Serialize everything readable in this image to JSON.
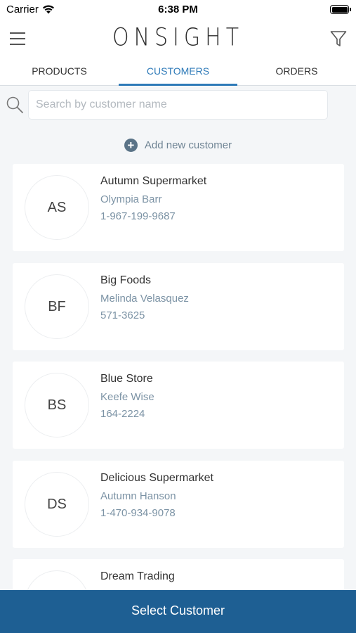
{
  "status_bar": {
    "carrier": "Carrier",
    "time": "6:38 PM"
  },
  "header": {
    "logo": "ONSIGHT",
    "menu_icon": "hamburger-menu-icon",
    "filter_icon": "filter-funnel-icon"
  },
  "tabs": [
    {
      "label": "PRODUCTS",
      "active": false
    },
    {
      "label": "CUSTOMERS",
      "active": true
    },
    {
      "label": "ORDERS",
      "active": false
    }
  ],
  "search": {
    "placeholder": "Search by customer name",
    "value": ""
  },
  "add_customer": {
    "label": "Add new customer",
    "icon": "plus-circle-icon"
  },
  "customers": [
    {
      "initials": "AS",
      "name": "Autumn Supermarket",
      "contact": "Olympia Barr",
      "phone": "1-967-199-9687"
    },
    {
      "initials": "BF",
      "name": "Big Foods",
      "contact": "Melinda Velasquez",
      "phone": "571-3625"
    },
    {
      "initials": "BS",
      "name": "Blue Store",
      "contact": "Keefe Wise",
      "phone": "164-2224"
    },
    {
      "initials": "DS",
      "name": "Delicious Supermarket",
      "contact": "Autumn Hanson",
      "phone": "1-470-934-9078"
    },
    {
      "initials": "",
      "name": "Dream Trading",
      "contact": "",
      "phone": ""
    }
  ],
  "footer": {
    "button_label": "Select Customer"
  },
  "colors": {
    "accent": "#2e7ab8",
    "footer": "#1e5f93",
    "secondary_text": "#7c93a5",
    "background": "#f4f6f8"
  }
}
